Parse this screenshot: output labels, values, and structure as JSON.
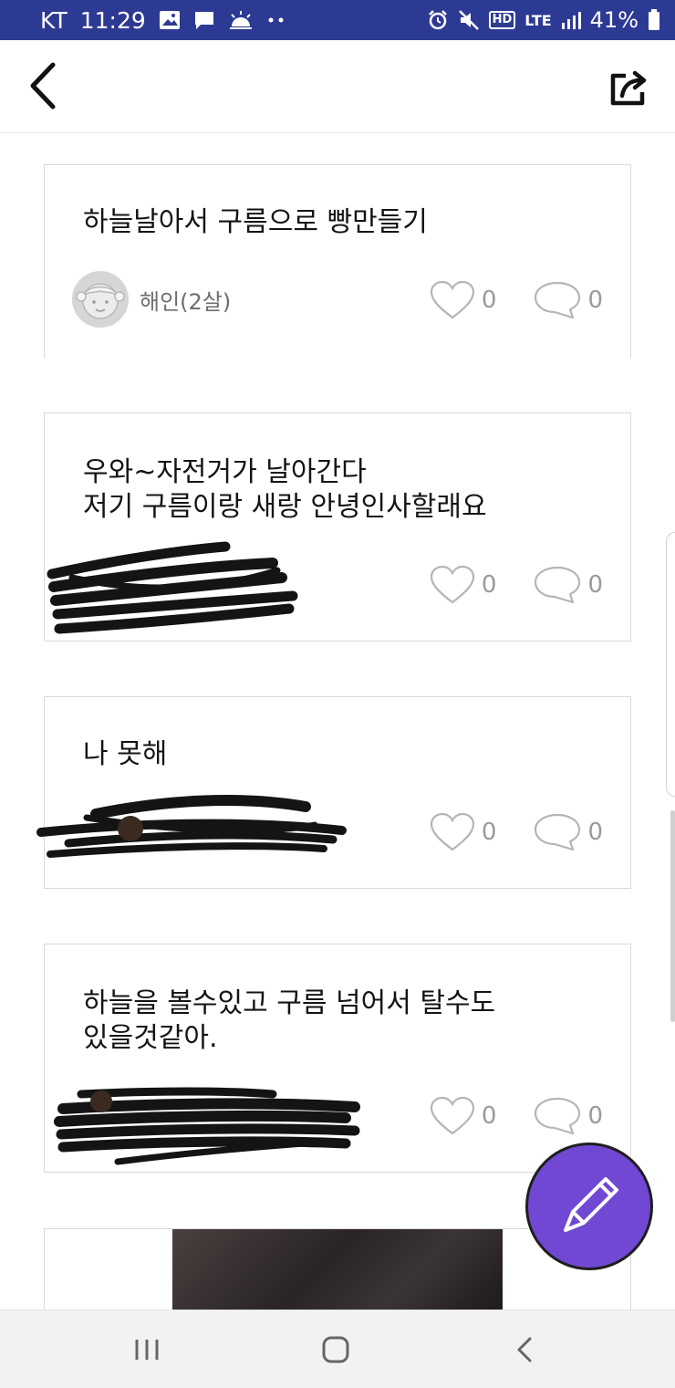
{
  "status_bar": {
    "carrier": "KT",
    "time": "11:29",
    "network": "LTE",
    "hd_label": "HD",
    "battery": "41%",
    "icons": [
      "image-icon",
      "message-icon",
      "weather-icon",
      "more-dots-icon",
      "alarm-icon",
      "mute-icon",
      "signal-icon",
      "battery-icon"
    ]
  },
  "header": {
    "back_icon": "chevron-left-icon",
    "share_icon": "share-icon"
  },
  "posts": [
    {
      "text": "하늘날아서 구름으로 빵만들기",
      "author": "해인(2살)",
      "likes": "0",
      "comments": "0",
      "author_redacted": false
    },
    {
      "text": "우와~자전거가 날아간다\n저기 구름이랑 새랑 안녕인사할래요",
      "author": "",
      "likes": "0",
      "comments": "0",
      "author_redacted": true
    },
    {
      "text": "나 못해",
      "author": "",
      "likes": "0",
      "comments": "0",
      "author_redacted": true
    },
    {
      "text": "하늘을 볼수있고 구름 넘어서 탈수도\n있을것같아.",
      "author": "",
      "likes": "0",
      "comments": "0",
      "author_redacted": true
    }
  ],
  "colors": {
    "status_bar": "#2d3a94",
    "fab": "#7048d4",
    "card_border": "#d9d9d9",
    "meta_text": "#9a9a9a"
  }
}
